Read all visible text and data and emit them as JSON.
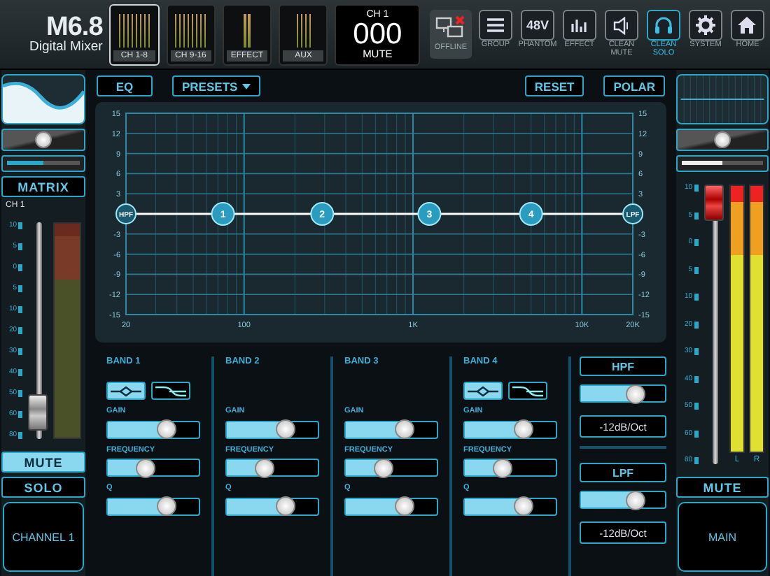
{
  "logo": {
    "model": "M6.8",
    "subtitle": "Digital Mixer"
  },
  "banks": [
    {
      "label": "CH 1-8",
      "selected": true,
      "meters": [
        {
          "level": 0.85
        },
        {
          "level": 0.85
        },
        {
          "level": 0.85
        },
        {
          "level": 0.85
        },
        {
          "level": 0.85
        },
        {
          "level": 0.85
        },
        {
          "level": 0.85
        },
        {
          "level": 0.85
        }
      ]
    },
    {
      "label": "CH 9-16",
      "selected": false,
      "meters": [
        {
          "level": 0.85
        },
        {
          "level": 0.85
        },
        {
          "level": 0.85
        },
        {
          "level": 0.85
        },
        {
          "level": 0.85
        },
        {
          "level": 0.85
        },
        {
          "level": 0.85
        },
        {
          "level": 0.85
        }
      ]
    },
    {
      "label": "EFFECT",
      "selected": false,
      "meters": [
        {
          "level": 0.85
        },
        {
          "level": 0.85
        }
      ]
    },
    {
      "label": "AUX",
      "selected": false,
      "meters": [
        {
          "level": 0.85
        },
        {
          "level": 0.85
        },
        {
          "level": 0.85
        },
        {
          "level": 0.85
        }
      ]
    }
  ],
  "display": {
    "channel": "CH 1",
    "value": "000",
    "status": "MUTE"
  },
  "toolbar": [
    {
      "kind": "offline",
      "label": "OFFLINE",
      "selected": false
    },
    {
      "kind": "group",
      "label": "GROUP",
      "selected": false
    },
    {
      "kind": "phantom",
      "label": "PHANTOM",
      "icon_text": "48V",
      "selected": false
    },
    {
      "kind": "effect",
      "label": "EFFECT",
      "selected": false
    },
    {
      "kind": "clean_mute",
      "label": "CLEAN MUTE",
      "selected": false
    },
    {
      "kind": "clean_solo",
      "label": "CLEAN SOLO",
      "selected": true
    },
    {
      "kind": "system",
      "label": "SYSTEM",
      "selected": false
    },
    {
      "kind": "home",
      "label": "HOME",
      "selected": false
    }
  ],
  "channel_strip": {
    "pan": {
      "level": 0.5
    },
    "send": {
      "level": 0.5
    },
    "matrix": "MATRIX",
    "label": "CH 1",
    "scale": [
      "10",
      "5",
      "0",
      "5",
      "10",
      "20",
      "30",
      "40",
      "50",
      "60",
      "80"
    ],
    "fader": {
      "level": 0.05
    },
    "meters": [
      {
        "level": 0
      }
    ],
    "buttons": [
      {
        "label": "MUTE",
        "selected": true
      },
      {
        "label": "SOLO",
        "selected": false
      }
    ],
    "name": "CHANNEL 1"
  },
  "eq": {
    "left_buttons": [
      {
        "label": "EQ"
      },
      {
        "label": "PRESETS",
        "has_menu": true
      }
    ],
    "right_buttons": [
      {
        "label": "RESET"
      },
      {
        "label": "POLAR"
      }
    ],
    "graph": {
      "x_labels": [
        "20",
        "100",
        "1K",
        "10K",
        "20K"
      ],
      "nodes": [
        {
          "label": "HPF",
          "kind": "filter"
        },
        {
          "label": "1",
          "kind": "band"
        },
        {
          "label": "2",
          "kind": "band"
        },
        {
          "label": "3",
          "kind": "band"
        },
        {
          "label": "4",
          "kind": "band"
        },
        {
          "label": "LPF",
          "kind": "filter"
        }
      ]
    },
    "left_axis_labels": [
      "15",
      "12",
      "9",
      "6",
      "3",
      "-3",
      "-6",
      "-9",
      "-12",
      "-15"
    ],
    "right_axis_labels": [
      "15",
      "12",
      "9",
      "6",
      "3",
      "-3",
      "-6",
      "-9",
      "-12",
      "-15"
    ]
  },
  "bands": [
    {
      "title": "BAND 1",
      "types": [
        {
          "kind": "bell",
          "selected": true
        },
        {
          "kind": "shelf",
          "selected": false
        }
      ],
      "controls": [
        {
          "label": "GAIN",
          "level": 0.68
        },
        {
          "label": "FREQUENCY",
          "level": 0.4
        },
        {
          "label": "Q",
          "level": 0.68
        }
      ]
    },
    {
      "title": "BAND 2",
      "controls": [
        {
          "label": "GAIN",
          "level": 0.68
        },
        {
          "label": "FREQUENCY",
          "level": 0.4
        },
        {
          "label": "Q",
          "level": 0.68
        }
      ]
    },
    {
      "title": "BAND 3",
      "controls": [
        {
          "label": "GAIN",
          "level": 0.68
        },
        {
          "label": "FREQUENCY",
          "level": 0.4
        },
        {
          "label": "Q",
          "level": 0.68
        }
      ]
    },
    {
      "title": "BAND 4",
      "types": [
        {
          "kind": "bell",
          "selected": true
        },
        {
          "kind": "shelf",
          "selected": false
        }
      ],
      "controls": [
        {
          "label": "GAIN",
          "level": 0.68
        },
        {
          "label": "FREQUENCY",
          "level": 0.4
        },
        {
          "label": "Q",
          "level": 0.68
        }
      ]
    }
  ],
  "filters": [
    {
      "label": "HPF",
      "level": 0.7,
      "slope": "-12dB/Oct"
    },
    {
      "label": "LPF",
      "level": 0.7,
      "slope": "-12dB/Oct"
    }
  ],
  "main_strip": {
    "pan": {
      "level": 0.5
    },
    "send": {
      "level": 0.5
    },
    "scale": [
      "10",
      "5",
      "0",
      "5",
      "10",
      "20",
      "30",
      "40",
      "50",
      "60",
      "80"
    ],
    "fader": {
      "level": 1
    },
    "meters": [
      {
        "label": "L",
        "level": 1
      },
      {
        "label": "R",
        "level": 1
      }
    ],
    "buttons": [
      {
        "label": "MUTE",
        "selected": false
      }
    ],
    "name": "MAIN"
  }
}
